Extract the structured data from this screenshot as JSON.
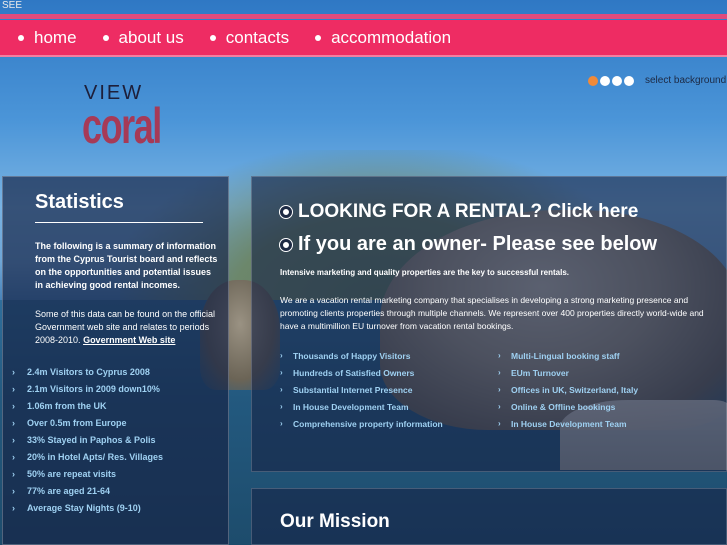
{
  "header": {
    "corner_text": "SEE"
  },
  "nav": {
    "items": [
      {
        "label": "home"
      },
      {
        "label": "about us"
      },
      {
        "label": "contacts"
      },
      {
        "label": "accommodation"
      }
    ]
  },
  "background_selector": {
    "label": "select background",
    "dots": [
      "active",
      "",
      "",
      ""
    ],
    "active_color": "#f08a3a"
  },
  "logo": {
    "line1": "VIEW",
    "line2": "coral"
  },
  "stats": {
    "title": "Statistics",
    "intro": "The following is a summary of information from the Cyprus Tourist board and reflects on the opportunities and potential issues in achieving good rental incomes.",
    "note": "Some of this data can be found on the official Government web site and relates to periods 2008-2010.",
    "link": "Government Web site",
    "items": [
      "2.4m Visitors to Cyprus 2008",
      "2.1m Visitors in 2009 down10%",
      "1.06m from the UK",
      "Over 0.5m from Europe",
      "33% Stayed in Paphos & Polis",
      "20% in Hotel Apts/ Res. Villages",
      "50% are repeat visits",
      "77% are aged 21-64",
      "Average Stay Nights (9-10)"
    ]
  },
  "main": {
    "cta_rental": "LOOKING FOR A RENTAL? Click here",
    "cta_owner": "If you are an owner- Please see below",
    "tagline": "Intensive marketing and quality properties are the key to successful rentals.",
    "description": "We are a vacation rental marketing company that specialises in developing a strong marketing presence and promoting clients properties through multiple channels. We represent over 400 properties directly world-wide and have a multimillion EU turnover from vacation rental bookings.",
    "features_left": [
      "Thousands of Happy Visitors",
      "Hundreds of Satisfied Owners",
      "Substantial Internet Presence",
      "In House Development Team",
      "Comprehensive property information"
    ],
    "features_right": [
      "Multi-Lingual booking staff",
      "EUm Turnover",
      "Offices in UK, Switzerland, Italy",
      "Online & Offline bookings",
      "In House Development Team"
    ]
  },
  "mission": {
    "title": "Our Mission"
  }
}
